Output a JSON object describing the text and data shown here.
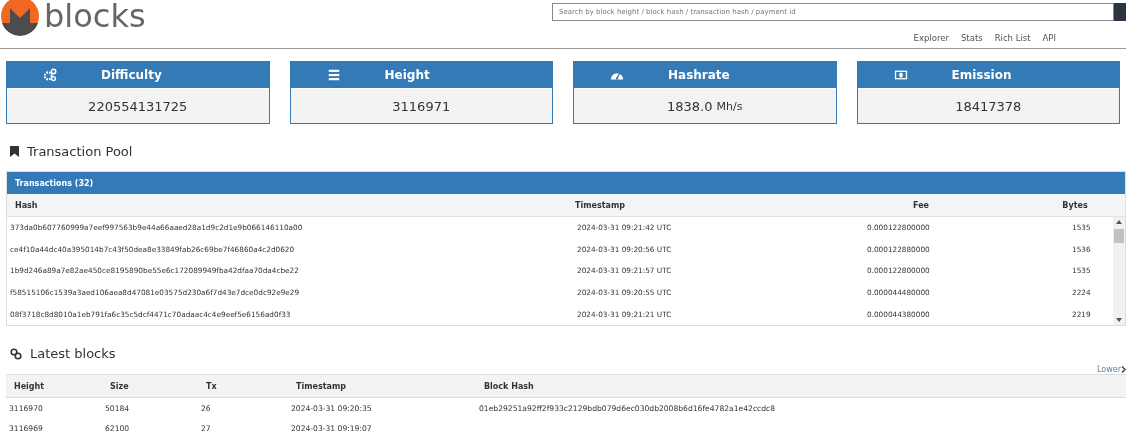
{
  "logo": {
    "text": "blocks"
  },
  "search": {
    "placeholder": "Search by block height / block hash / transaction hash / payment id"
  },
  "nav": [
    "Explorer",
    "Stats",
    "Rich List",
    "API"
  ],
  "stats": [
    {
      "kind": "gears",
      "title": "Difficulty",
      "value": "220554131725"
    },
    {
      "kind": "bars",
      "title": "Height",
      "value": "3116971"
    },
    {
      "kind": "gauge",
      "title": "Hashrate",
      "value": "1838.0",
      "unit": "Mh/s"
    },
    {
      "kind": "money",
      "title": "Emission",
      "value": "18417378"
    }
  ],
  "pool": {
    "title": "Transaction Pool",
    "panel_title": "Transactions (32)",
    "columns": [
      "Hash",
      "Timestamp",
      "Fee",
      "Bytes"
    ],
    "rows": [
      [
        "373da0b607760999a7eef997563b9e44a66aaed28a1d9c2d1e9b066146110a00",
        "2024-03-31 09:21:42 UTC",
        "0.000122800000",
        "1535"
      ],
      [
        "ce4f10a44dc40a395014b7c43f50dea8e33849fab26c69be7f46860a4c2d0620",
        "2024-03-31 09:20:56 UTC",
        "0.000122880000",
        "1536"
      ],
      [
        "1b9d246a89a7e82ae450ce8195890be55e6c172089949fba42dfaa70da4cbe22",
        "2024-03-31 09:21:57 UTC",
        "0.000122800000",
        "1535"
      ],
      [
        "f58515106c1539a3aed106aea8d47081e03575d230a6f7d43e7dce0dc92e9e29",
        "2024-03-31 09:20:55 UTC",
        "0.000044480000",
        "2224"
      ],
      [
        "08f3718c8d8010a1eb791fa6c35c5dcf4471c70adaac4c4e9eef5e6156ad0f33",
        "2024-03-31 09:21:21 UTC",
        "0.000044380000",
        "2219"
      ]
    ]
  },
  "blocks": {
    "title": "Latest blocks",
    "pager": "Lower",
    "columns": [
      "Height",
      "Size",
      "Tx",
      "Timestamp",
      "Block Hash"
    ],
    "rows": [
      [
        "3116970",
        "50184",
        "26",
        "2024-03-31 09:20:35",
        "01eb29251a92ff2f933c2129bdb079d6ec030db2008b6d16fe4782a1e42ccdc8"
      ],
      [
        "3116969",
        "62100",
        "27",
        "2024-03-31 09:19:07"
      ]
    ]
  }
}
